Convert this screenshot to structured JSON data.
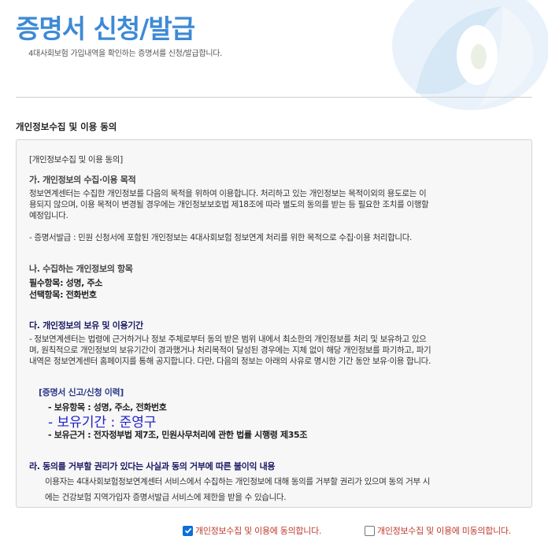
{
  "header": {
    "title": "증명서 신청/발급",
    "subtitle": "4대사회보험 가입내역을 확인하는 증명서를 신청/발급합니다."
  },
  "section": {
    "label": "개인정보수집 및 이용 동의"
  },
  "consent": {
    "box_title": "[개인정보수집 및 이용 동의]",
    "a_heading": "가. 개인정보의 수집·이용 목적",
    "a_body_1": "정보연계센터는 수집한 개인정보를 다음의 목적을 위하여 이용합니다. 처리하고 있는 개인정보는 목적이외의 용도로는 이",
    "a_body_2": "용되지 않으며, 이용 목적이 변경될 경우에는 개인정보보호법 제18조에 따라 별도의 동의를 받는 등 필요한 조치를 이행할",
    "a_body_3": "예정입니다.",
    "a_item": "- 증명서발급 : 민원 신청서에 포함된 개인정보는 4대사회보험 정보연계 처리를 위한 목적으로 수집·이용 처리합니다.",
    "b_heading": "나. 수집하는 개인정보의 항목",
    "b_required": "필수항목: 성명, 주소",
    "b_optional": "선택항목: 전화번호",
    "c_heading": "다. 개인정보의 보유 및 이용기간",
    "c_body_1": "- 정보연계센터는 법령에 근거하거나 정보 주체로부터 동의 받은 범위 내에서 최소한의 개인정보를 처리 및 보유하고 있으",
    "c_body_2": "며, 원칙적으로 개인정보의 보유기간이 경과했거나 처리목적이 달성된 경우에는 지체 없이 해당 개인정보를 파기하고, 파기",
    "c_body_3": "내역은 정보연계센터 홈페이지를 통해 공지합니다. 다만, 다음의 정보는 아래의 사유로 명시한 기간 동안 보유·이용 합니다.",
    "c_sub_heading": "[증명서 신고/신청 이력]",
    "c_sub_items": "- 보유항목 : 성명, 주소, 전화번호",
    "c_sub_period": "- 보유기간 : 준영구",
    "c_sub_basis": "- 보유근거 : 전자정부법 제7조, 민원사무처리에 관한 법률 시행령 제35조",
    "d_heading": "라. 동의를 거부할 권리가 있다는 사실과 동의 거부에 따른 불이익 내용",
    "d_body_1": "이용자는 4대사회보험정보연계센터 서비스에서 수집하는 개인정보에 대해 동의를 거부할 권리가 있으며 동의 거부 시",
    "d_body_2": "에는 건강보험 지역가입자 증명서발급 서비스에 제한을 받을 수 있습니다."
  },
  "agreement": {
    "agree_label": "개인정보수집 및 이용에 동의합니다.",
    "agree_checked": true,
    "disagree_label": "개인정보수집 및 이용에 미동의합니다.",
    "disagree_checked": false
  },
  "colors": {
    "title": "#3d8ad6",
    "agree_text": "#c0392b",
    "checkbox_checked": "#0b6fd9",
    "emphasis_blue": "#2222cc"
  }
}
